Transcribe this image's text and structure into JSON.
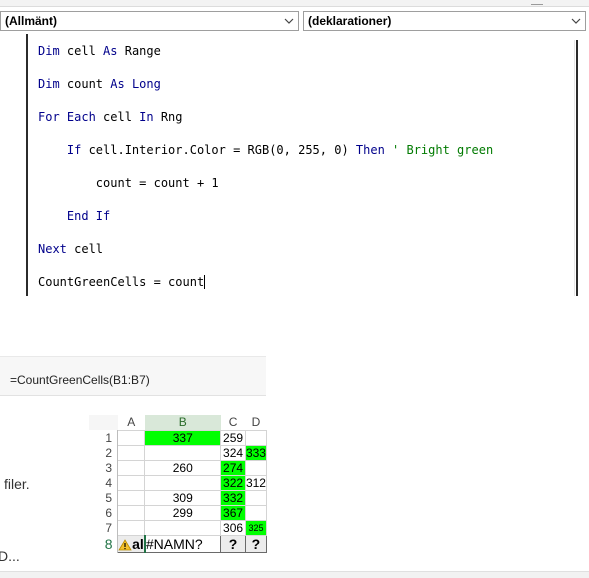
{
  "vba_editor": {
    "object_combo": "(Allmänt)",
    "procedure_combo": "(deklarationer)",
    "code": [
      [
        {
          "t": "Dim",
          "c": "kw"
        },
        {
          "t": " cell "
        },
        {
          "t": "As",
          "c": "kw"
        },
        {
          "t": " Range"
        }
      ],
      [
        {
          "t": "Dim",
          "c": "kw"
        },
        {
          "t": " count "
        },
        {
          "t": "As",
          "c": "kw"
        },
        {
          "t": " "
        },
        {
          "t": "Long",
          "c": "kw"
        }
      ],
      [
        {
          "t": "For Each",
          "c": "kw"
        },
        {
          "t": " cell "
        },
        {
          "t": "In",
          "c": "kw"
        },
        {
          "t": " Rng"
        }
      ],
      [
        {
          "t": "    "
        },
        {
          "t": "If",
          "c": "kw"
        },
        {
          "t": " cell.Interior.Color = RGB(0, 255, 0) "
        },
        {
          "t": "Then",
          "c": "kw"
        },
        {
          "t": " ' Bright green",
          "c": "cm"
        }
      ],
      [
        {
          "t": "        count = count + 1"
        }
      ],
      [
        {
          "t": "    "
        },
        {
          "t": "End If",
          "c": "kw"
        }
      ],
      [
        {
          "t": "Next",
          "c": "kw"
        },
        {
          "t": " cell"
        }
      ],
      [
        {
          "t": "CountGreenCells = count"
        },
        {
          "t": "",
          "caret": true
        }
      ]
    ]
  },
  "excel": {
    "formula": "=CountGreenCells(B1:B7)",
    "columns": [
      "A",
      "B",
      "C",
      "D"
    ],
    "rows": [
      {
        "num": "1",
        "A": "",
        "B": "337",
        "C": "259",
        "D": ""
      },
      {
        "num": "2",
        "A": "",
        "B": "",
        "C": "324",
        "D": "333"
      },
      {
        "num": "3",
        "A": "",
        "B": "260",
        "C": "274",
        "D": ""
      },
      {
        "num": "4",
        "A": "",
        "B": "",
        "C": "322",
        "D": "312"
      },
      {
        "num": "5",
        "A": "",
        "B": "309",
        "C": "332",
        "D": ""
      },
      {
        "num": "6",
        "A": "",
        "B": "299",
        "C": "367",
        "D": ""
      },
      {
        "num": "7",
        "A": "",
        "B": "",
        "C": "306",
        "D": "325"
      }
    ],
    "row8": {
      "num": "8",
      "A": "al",
      "B": "#NAMN?",
      "C": "?",
      "D": "?"
    },
    "green_cells": [
      "B1",
      "D2",
      "C3",
      "C4",
      "C5",
      "C6",
      "D7"
    ],
    "green_color": "#00ff00",
    "side_text_1": "filer.",
    "side_text_2": "D..."
  }
}
